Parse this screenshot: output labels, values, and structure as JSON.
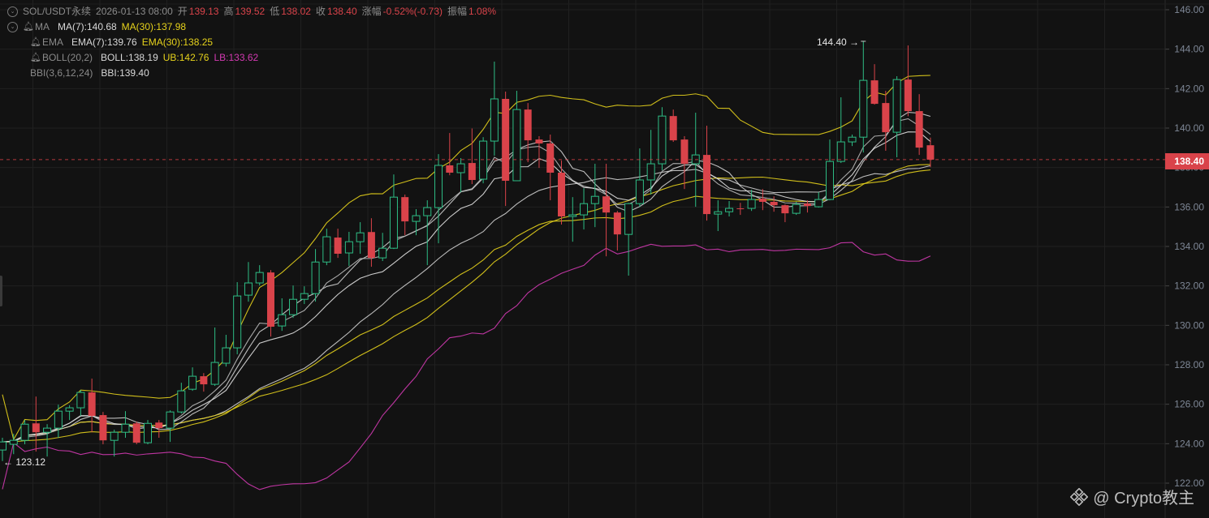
{
  "header": {
    "symbol": "SOL/USDT永续",
    "datetime": "2026-01-13 08:00",
    "open_label": "开",
    "open": "139.13",
    "high_label": "高",
    "high": "139.52",
    "low_label": "低",
    "low": "138.02",
    "close_label": "收",
    "close": "138.40",
    "change_label": "涨幅",
    "change": "-0.52%(-0.73)",
    "amplitude_label": "振幅",
    "amplitude": "1.08%"
  },
  "indicators": {
    "ma": {
      "name": "MA",
      "ma7": "MA(7):140.68",
      "ma30": "MA(30):137.98"
    },
    "ema": {
      "name": "EMA",
      "ema7": "EMA(7):139.76",
      "ema30": "EMA(30):138.25"
    },
    "boll": {
      "name": "BOLL(20,2)",
      "mid": "BOLL:138.19",
      "ub": "UB:142.76",
      "lb": "LB:133.62"
    },
    "bbi": {
      "name": "BBI(3,6,12,24)",
      "value": "BBI:139.40"
    }
  },
  "annotations": {
    "high_marker": "144.40 →",
    "low_marker": "← 123.12"
  },
  "last_price_tag": "138.40",
  "watermark": "@ Crypto教主",
  "colors": {
    "up": "#2ebd85",
    "down": "#d9434a",
    "yellow": "#e6d21c",
    "white": "#cfcfcf",
    "magenta": "#d23ab1",
    "grid": "#202020",
    "axis_text": "#7e8796"
  },
  "chart_data": {
    "type": "candlestick",
    "title": "SOL/USDT永续",
    "ylim": [
      122,
      146
    ],
    "y_ticks": [
      "146.00",
      "144.00",
      "142.00",
      "140.00",
      "138.00",
      "136.00",
      "134.00",
      "132.00",
      "130.00",
      "128.00",
      "126.00",
      "124.00",
      "122.00"
    ],
    "grid": true,
    "candles": [
      [
        123.68,
        124.3,
        123.12,
        124.09
      ],
      [
        123.97,
        124.5,
        123.47,
        124.17
      ],
      [
        124.17,
        125.2,
        123.97,
        124.99
      ],
      [
        125.03,
        126.39,
        123.6,
        124.58
      ],
      [
        124.58,
        124.99,
        123.35,
        124.79
      ],
      [
        124.79,
        125.98,
        124.3,
        125.65
      ],
      [
        125.65,
        125.95,
        125.2,
        125.82
      ],
      [
        125.82,
        126.72,
        125.41,
        126.6
      ],
      [
        126.6,
        127.3,
        124.58,
        125.41
      ],
      [
        125.45,
        125.61,
        123.97,
        124.17
      ],
      [
        124.17,
        124.71,
        123.35,
        124.58
      ],
      [
        124.58,
        125.65,
        124.3,
        124.99
      ],
      [
        125.03,
        125.12,
        123.97,
        124.05
      ],
      [
        124.05,
        125.2,
        123.97,
        125.03
      ],
      [
        125.07,
        125.2,
        124.3,
        124.79
      ],
      [
        124.79,
        125.69,
        124.09,
        125.61
      ],
      [
        125.61,
        127.09,
        125.53,
        126.68
      ],
      [
        126.76,
        127.87,
        126.68,
        127.42
      ],
      [
        127.42,
        127.58,
        126.64,
        127.01
      ],
      [
        127.01,
        129.89,
        126.93,
        128.12
      ],
      [
        128.08,
        129.52,
        127.91,
        128.86
      ],
      [
        128.86,
        132.19,
        128.53,
        131.49
      ],
      [
        131.53,
        133.21,
        131.2,
        132.15
      ],
      [
        132.15,
        133.05,
        132.02,
        132.68
      ],
      [
        132.68,
        132.8,
        129.43,
        129.93
      ],
      [
        129.97,
        131.37,
        129.72,
        130.54
      ],
      [
        130.54,
        132.02,
        130.38,
        131.32
      ],
      [
        131.32,
        131.98,
        131.08,
        131.61
      ],
      [
        131.61,
        133.87,
        131.2,
        133.21
      ],
      [
        133.21,
        134.9,
        133.05,
        134.49
      ],
      [
        134.45,
        134.9,
        133.42,
        133.63
      ],
      [
        133.67,
        134.74,
        133.01,
        134.24
      ],
      [
        134.24,
        135.23,
        133.63,
        134.69
      ],
      [
        134.73,
        135.43,
        132.97,
        133.42
      ],
      [
        133.42,
        134.69,
        133.26,
        133.91
      ],
      [
        133.91,
        137.65,
        133.87,
        136.5
      ],
      [
        136.5,
        136.63,
        134.57,
        135.27
      ],
      [
        135.27,
        135.89,
        134.57,
        135.56
      ],
      [
        135.56,
        136.34,
        133.05,
        135.97
      ],
      [
        135.97,
        138.68,
        134.16,
        138.11
      ],
      [
        138.11,
        139.75,
        137.61,
        137.74
      ],
      [
        137.74,
        138.48,
        136.75,
        138.19
      ],
      [
        138.23,
        139.98,
        137.16,
        137.37
      ],
      [
        137.41,
        139.54,
        137.2,
        139.34
      ],
      [
        139.34,
        143.37,
        138.6,
        141.48
      ],
      [
        141.48,
        141.85,
        136.05,
        137.33
      ],
      [
        137.33,
        141.89,
        137.33,
        140.94
      ],
      [
        140.94,
        141.27,
        138.27,
        139.38
      ],
      [
        139.42,
        139.59,
        137.98,
        139.22
      ],
      [
        139.22,
        139.67,
        136.34,
        137.74
      ],
      [
        137.74,
        138.35,
        135.11,
        135.52
      ],
      [
        135.52,
        136.5,
        134.24,
        135.6
      ],
      [
        135.6,
        136.95,
        134.86,
        136.17
      ],
      [
        136.17,
        138.19,
        134.98,
        136.54
      ],
      [
        136.54,
        138.19,
        133.5,
        135.72
      ],
      [
        135.72,
        135.8,
        133.79,
        134.61
      ],
      [
        134.61,
        136.21,
        132.52,
        136.17
      ],
      [
        136.17,
        138.97,
        136.01,
        137.37
      ],
      [
        137.37,
        139.91,
        136.63,
        138.19
      ],
      [
        138.19,
        141.06,
        137.86,
        140.61
      ],
      [
        140.61,
        140.94,
        139.3,
        139.38
      ],
      [
        139.42,
        139.59,
        136.91,
        138.19
      ],
      [
        138.19,
        140.78,
        136.01,
        138.64
      ],
      [
        138.64,
        140.12,
        135.31,
        135.64
      ],
      [
        135.64,
        136.34,
        134.78,
        135.76
      ],
      [
        135.76,
        136.3,
        135.52,
        135.93
      ],
      [
        135.93,
        136.21,
        135.6,
        135.89
      ],
      [
        135.93,
        136.87,
        135.8,
        136.38
      ],
      [
        136.42,
        136.91,
        135.84,
        136.26
      ],
      [
        136.26,
        136.54,
        135.76,
        136.09
      ],
      [
        136.09,
        136.13,
        135.23,
        135.68
      ],
      [
        135.68,
        136.26,
        135.6,
        136.13
      ],
      [
        136.17,
        136.34,
        135.72,
        136.05
      ],
      [
        136.01,
        136.75,
        135.97,
        136.38
      ],
      [
        136.38,
        139.42,
        136.34,
        138.31
      ],
      [
        138.31,
        141.56,
        138.23,
        139.3
      ],
      [
        139.3,
        139.67,
        139.09,
        139.54
      ],
      [
        139.54,
        144.4,
        138.76,
        142.42
      ],
      [
        142.42,
        143.24,
        141.19,
        141.23
      ],
      [
        141.27,
        141.89,
        138.85,
        139.79
      ],
      [
        139.79,
        142.63,
        138.52,
        142.46
      ],
      [
        142.46,
        144.19,
        140.6,
        140.86
      ],
      [
        140.86,
        141.72,
        138.64,
        139.01
      ],
      [
        139.13,
        139.52,
        138.02,
        138.4
      ]
    ],
    "series": [
      "MA(7)",
      "MA(30)",
      "EMA(7)",
      "EMA(30)",
      "BOLL",
      "UB",
      "LB",
      "BBI"
    ]
  }
}
